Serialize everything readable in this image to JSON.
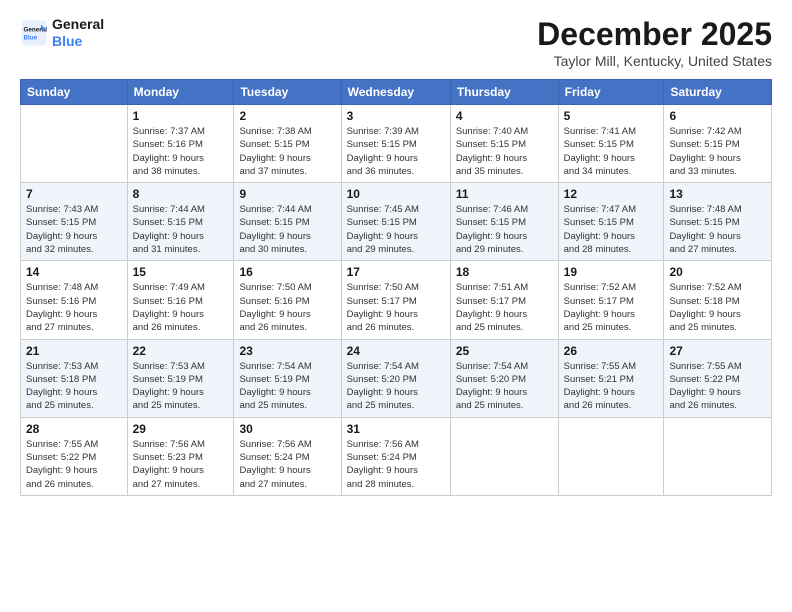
{
  "logo": {
    "line1": "General",
    "line2": "Blue"
  },
  "title": "December 2025",
  "subtitle": "Taylor Mill, Kentucky, United States",
  "days_header": [
    "Sunday",
    "Monday",
    "Tuesday",
    "Wednesday",
    "Thursday",
    "Friday",
    "Saturday"
  ],
  "weeks": [
    [
      {
        "num": "",
        "info": ""
      },
      {
        "num": "1",
        "info": "Sunrise: 7:37 AM\nSunset: 5:16 PM\nDaylight: 9 hours\nand 38 minutes."
      },
      {
        "num": "2",
        "info": "Sunrise: 7:38 AM\nSunset: 5:15 PM\nDaylight: 9 hours\nand 37 minutes."
      },
      {
        "num": "3",
        "info": "Sunrise: 7:39 AM\nSunset: 5:15 PM\nDaylight: 9 hours\nand 36 minutes."
      },
      {
        "num": "4",
        "info": "Sunrise: 7:40 AM\nSunset: 5:15 PM\nDaylight: 9 hours\nand 35 minutes."
      },
      {
        "num": "5",
        "info": "Sunrise: 7:41 AM\nSunset: 5:15 PM\nDaylight: 9 hours\nand 34 minutes."
      },
      {
        "num": "6",
        "info": "Sunrise: 7:42 AM\nSunset: 5:15 PM\nDaylight: 9 hours\nand 33 minutes."
      }
    ],
    [
      {
        "num": "7",
        "info": "Sunrise: 7:43 AM\nSunset: 5:15 PM\nDaylight: 9 hours\nand 32 minutes."
      },
      {
        "num": "8",
        "info": "Sunrise: 7:44 AM\nSunset: 5:15 PM\nDaylight: 9 hours\nand 31 minutes."
      },
      {
        "num": "9",
        "info": "Sunrise: 7:44 AM\nSunset: 5:15 PM\nDaylight: 9 hours\nand 30 minutes."
      },
      {
        "num": "10",
        "info": "Sunrise: 7:45 AM\nSunset: 5:15 PM\nDaylight: 9 hours\nand 29 minutes."
      },
      {
        "num": "11",
        "info": "Sunrise: 7:46 AM\nSunset: 5:15 PM\nDaylight: 9 hours\nand 29 minutes."
      },
      {
        "num": "12",
        "info": "Sunrise: 7:47 AM\nSunset: 5:15 PM\nDaylight: 9 hours\nand 28 minutes."
      },
      {
        "num": "13",
        "info": "Sunrise: 7:48 AM\nSunset: 5:15 PM\nDaylight: 9 hours\nand 27 minutes."
      }
    ],
    [
      {
        "num": "14",
        "info": "Sunrise: 7:48 AM\nSunset: 5:16 PM\nDaylight: 9 hours\nand 27 minutes."
      },
      {
        "num": "15",
        "info": "Sunrise: 7:49 AM\nSunset: 5:16 PM\nDaylight: 9 hours\nand 26 minutes."
      },
      {
        "num": "16",
        "info": "Sunrise: 7:50 AM\nSunset: 5:16 PM\nDaylight: 9 hours\nand 26 minutes."
      },
      {
        "num": "17",
        "info": "Sunrise: 7:50 AM\nSunset: 5:17 PM\nDaylight: 9 hours\nand 26 minutes."
      },
      {
        "num": "18",
        "info": "Sunrise: 7:51 AM\nSunset: 5:17 PM\nDaylight: 9 hours\nand 25 minutes."
      },
      {
        "num": "19",
        "info": "Sunrise: 7:52 AM\nSunset: 5:17 PM\nDaylight: 9 hours\nand 25 minutes."
      },
      {
        "num": "20",
        "info": "Sunrise: 7:52 AM\nSunset: 5:18 PM\nDaylight: 9 hours\nand 25 minutes."
      }
    ],
    [
      {
        "num": "21",
        "info": "Sunrise: 7:53 AM\nSunset: 5:18 PM\nDaylight: 9 hours\nand 25 minutes."
      },
      {
        "num": "22",
        "info": "Sunrise: 7:53 AM\nSunset: 5:19 PM\nDaylight: 9 hours\nand 25 minutes."
      },
      {
        "num": "23",
        "info": "Sunrise: 7:54 AM\nSunset: 5:19 PM\nDaylight: 9 hours\nand 25 minutes."
      },
      {
        "num": "24",
        "info": "Sunrise: 7:54 AM\nSunset: 5:20 PM\nDaylight: 9 hours\nand 25 minutes."
      },
      {
        "num": "25",
        "info": "Sunrise: 7:54 AM\nSunset: 5:20 PM\nDaylight: 9 hours\nand 25 minutes."
      },
      {
        "num": "26",
        "info": "Sunrise: 7:55 AM\nSunset: 5:21 PM\nDaylight: 9 hours\nand 26 minutes."
      },
      {
        "num": "27",
        "info": "Sunrise: 7:55 AM\nSunset: 5:22 PM\nDaylight: 9 hours\nand 26 minutes."
      }
    ],
    [
      {
        "num": "28",
        "info": "Sunrise: 7:55 AM\nSunset: 5:22 PM\nDaylight: 9 hours\nand 26 minutes."
      },
      {
        "num": "29",
        "info": "Sunrise: 7:56 AM\nSunset: 5:23 PM\nDaylight: 9 hours\nand 27 minutes."
      },
      {
        "num": "30",
        "info": "Sunrise: 7:56 AM\nSunset: 5:24 PM\nDaylight: 9 hours\nand 27 minutes."
      },
      {
        "num": "31",
        "info": "Sunrise: 7:56 AM\nSunset: 5:24 PM\nDaylight: 9 hours\nand 28 minutes."
      },
      {
        "num": "",
        "info": ""
      },
      {
        "num": "",
        "info": ""
      },
      {
        "num": "",
        "info": ""
      }
    ]
  ]
}
